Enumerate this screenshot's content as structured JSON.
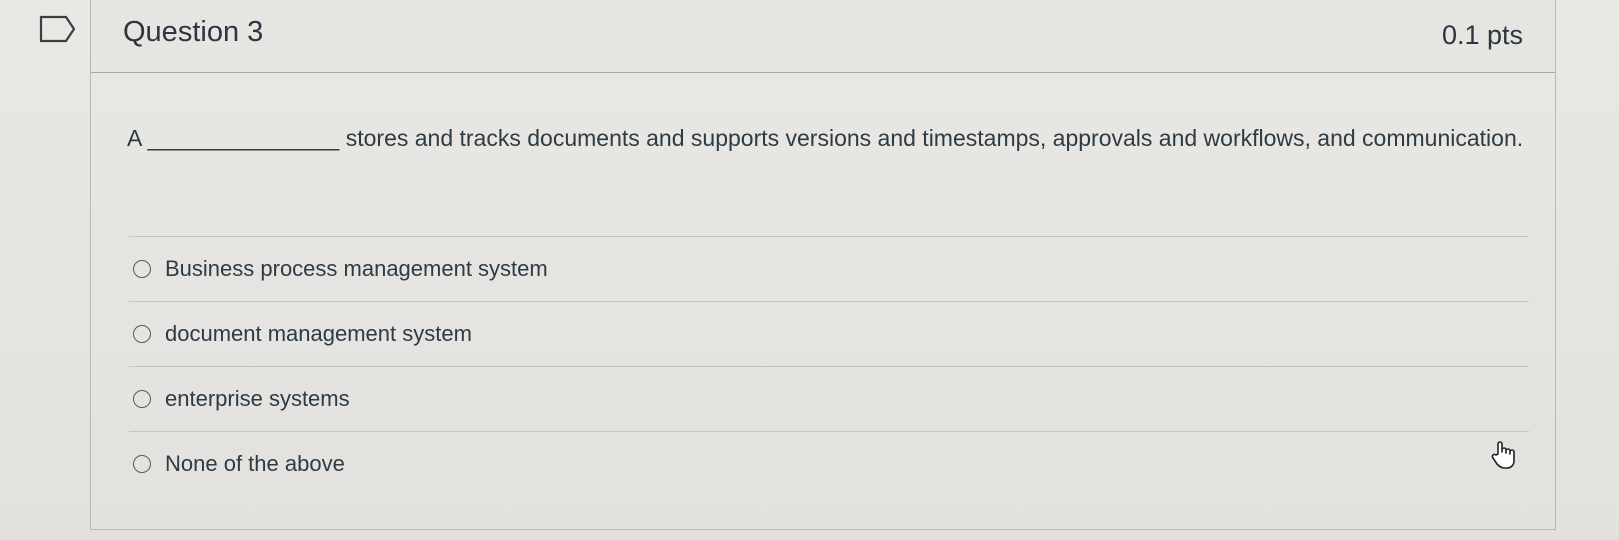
{
  "question": {
    "title": "Question 3",
    "points": "0.1 pts",
    "text": "A _______________ stores and tracks documents and supports versions and timestamps, approvals and workflows, and communication."
  },
  "answers": [
    {
      "label": "Business process management system"
    },
    {
      "label": "document management system"
    },
    {
      "label": "enterprise systems"
    },
    {
      "label": "None of the above"
    }
  ],
  "icons": {
    "flag": "flag-icon",
    "cursor": "hand-pointer-icon"
  },
  "colors": {
    "text": "#2d3b45",
    "background": "#e4e3df",
    "border": "#b9b8b3"
  }
}
